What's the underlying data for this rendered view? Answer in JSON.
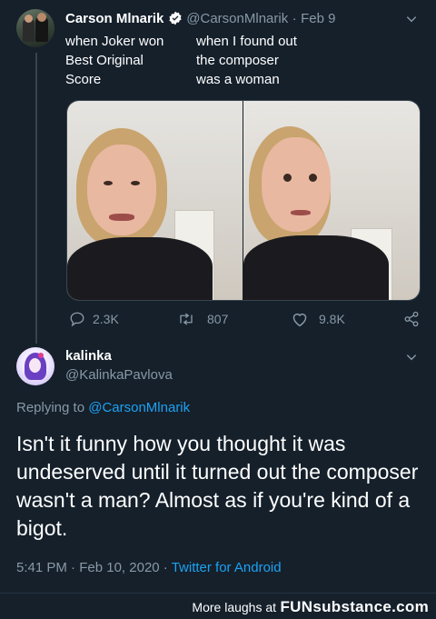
{
  "colors": {
    "background": "#15202b",
    "text_primary": "#ffffff",
    "text_secondary": "#8899a6",
    "link": "#1da1f2",
    "divider": "#38444d"
  },
  "tweet": {
    "author_name": "Carson Mlnarik",
    "author_handle": "@CarsonMlnarik",
    "date_sep": "·",
    "date": "Feb 9",
    "verified_icon": "verified-badge-icon",
    "caption_left": "when Joker won\nBest Original\nScore",
    "caption_right": "when I found out\nthe composer\nwas a woman",
    "media": [
      {
        "name": "photo-left",
        "icon": "image-icon"
      },
      {
        "name": "photo-right",
        "icon": "image-icon"
      }
    ],
    "actions": {
      "replies": "2.3K",
      "retweets": "807",
      "likes": "9.8K",
      "reply_icon": "reply-icon",
      "retweet_icon": "retweet-icon",
      "like_icon": "heart-icon",
      "share_icon": "share-icon"
    }
  },
  "reply": {
    "author_name": "kalinka",
    "author_handle": "@KalinkaPavlova",
    "replying_prefix": "Replying to",
    "replying_to": "@CarsonMlnarik",
    "text": "Isn't it funny how you thought it was undeserved until it turned out the composer wasn't a man? Almost as if you're kind of a bigot.",
    "time": "5:41 PM",
    "date_sep": "·",
    "date": "Feb 10, 2020",
    "client_sep": "·",
    "client": "Twitter for Android"
  },
  "footer": {
    "text": "More laughs at",
    "logo": "FUNsubstance.com"
  }
}
